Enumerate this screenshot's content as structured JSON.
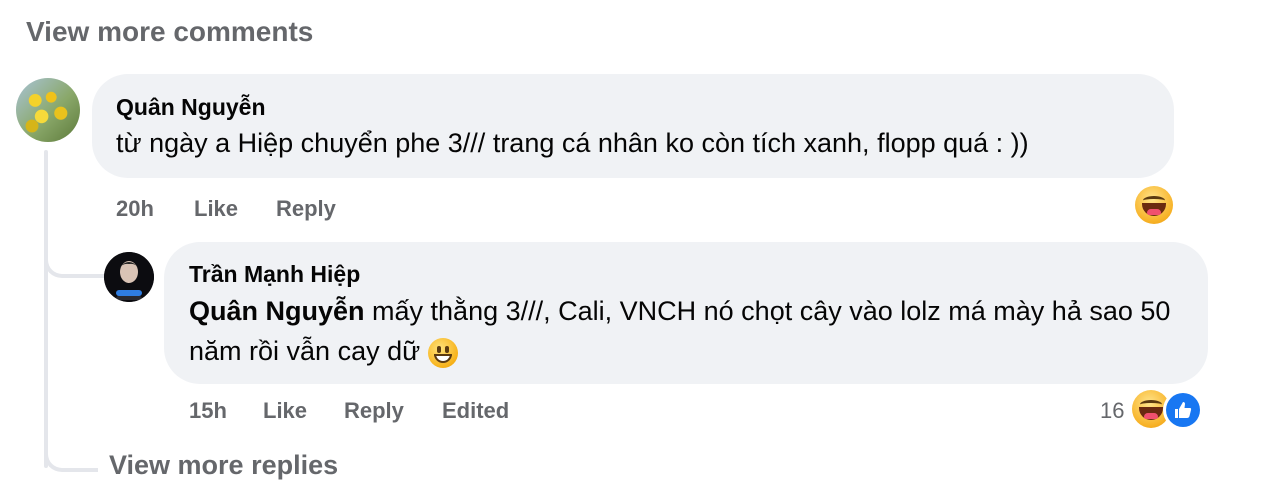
{
  "thread": {
    "view_more_comments": "View more comments",
    "view_more_replies": "View more replies"
  },
  "comment": {
    "author": "Quân Nguyễn",
    "text": "từ ngày a Hiệp chuyển phe 3/// trang cá nhân ko còn tích xanh, flopp quá : ))",
    "time": "20h",
    "like_label": "Like",
    "reply_label": "Reply",
    "reactions": [
      "haha-icon"
    ]
  },
  "reply": {
    "author": "Trần Mạnh Hiệp",
    "mention": "Quân Nguyễn",
    "text": "mấy thằng 3///, Cali, VNCH nó chọt cây vào lolz má mày hả sao 50 năm rồi vẫn cay dữ",
    "inline_emoji": "grinning-face-icon",
    "time": "15h",
    "like_label": "Like",
    "reply_label": "Reply",
    "edited_label": "Edited",
    "reaction_count": "16",
    "reactions": [
      "haha-icon",
      "like-icon"
    ]
  },
  "colors": {
    "bubble_bg": "#f0f2f5",
    "meta_text": "#65676b",
    "like_blue": "#1877f2"
  }
}
